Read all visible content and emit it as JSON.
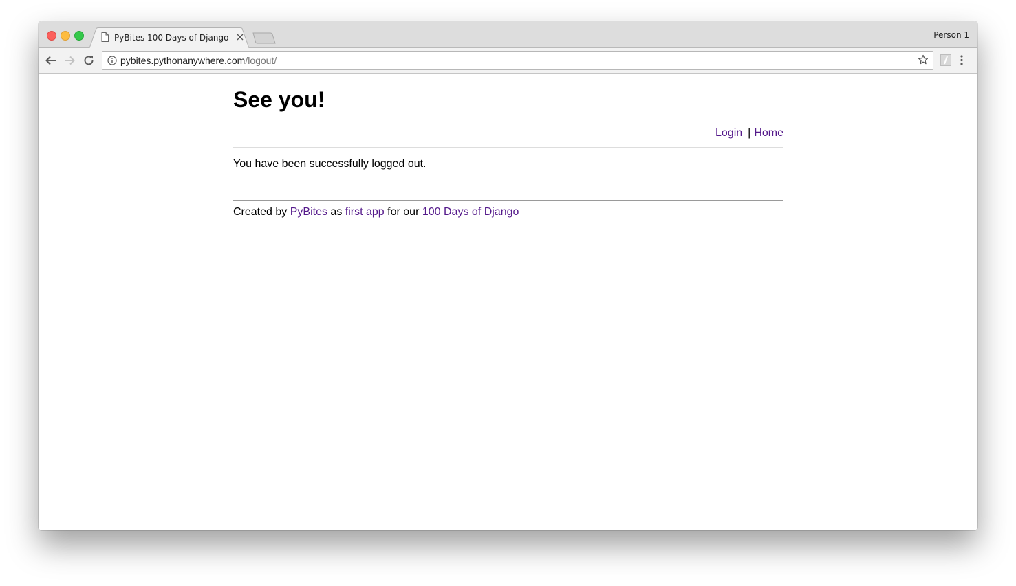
{
  "browser": {
    "tab_title": "PyBites 100 Days of Django",
    "profile_name": "Person 1",
    "url_host": "pybites.pythonanywhere.com",
    "url_path": "/logout/"
  },
  "page": {
    "heading": "See you!",
    "nav": {
      "login": "Login",
      "separator": "|",
      "home": "Home"
    },
    "message": "You have been successfully logged out.",
    "footer": {
      "prefix": "Created by",
      "pybites_link": "PyBites",
      "as": "as",
      "first_app_link": "first app",
      "for_our": "for our",
      "course_link": "100 Days of Django"
    }
  },
  "colors": {
    "link_visited": "#551a8b",
    "tab_bar": "#dddddd",
    "toolbar": "#f2f2f2"
  }
}
